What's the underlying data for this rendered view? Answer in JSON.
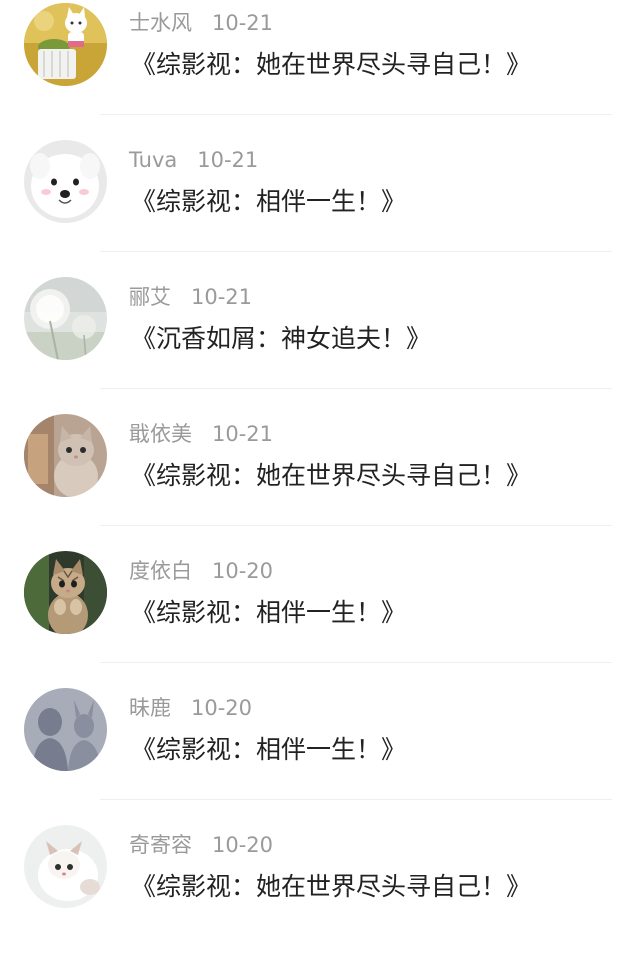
{
  "comments": [
    {
      "user": "士水风",
      "date": "10-21",
      "text": "《综影视：她在世界尽头寻自己！》",
      "avatar": "cat-toy-avatar"
    },
    {
      "user": "Tuva",
      "date": "10-21",
      "text": "《综影视：相伴一生！》",
      "avatar": "samoyed-dog-avatar"
    },
    {
      "user": "郦艾",
      "date": "10-21",
      "text": "《沉香如屑：神女追夫！》",
      "avatar": "dandelion-avatar"
    },
    {
      "user": "戢依美",
      "date": "10-21",
      "text": "《综影视：她在世界尽头寻自己！》",
      "avatar": "kitten-avatar"
    },
    {
      "user": "度依白",
      "date": "10-20",
      "text": "《综影视：相伴一生！》",
      "avatar": "tabby-kitten-avatar"
    },
    {
      "user": "昧鹿",
      "date": "10-20",
      "text": "《综影视：相伴一生！》",
      "avatar": "silhouette-avatar"
    },
    {
      "user": "奇寄容",
      "date": "10-20",
      "text": "《综影视：她在世界尽头寻自己！》",
      "avatar": "white-kitten-avatar"
    }
  ]
}
